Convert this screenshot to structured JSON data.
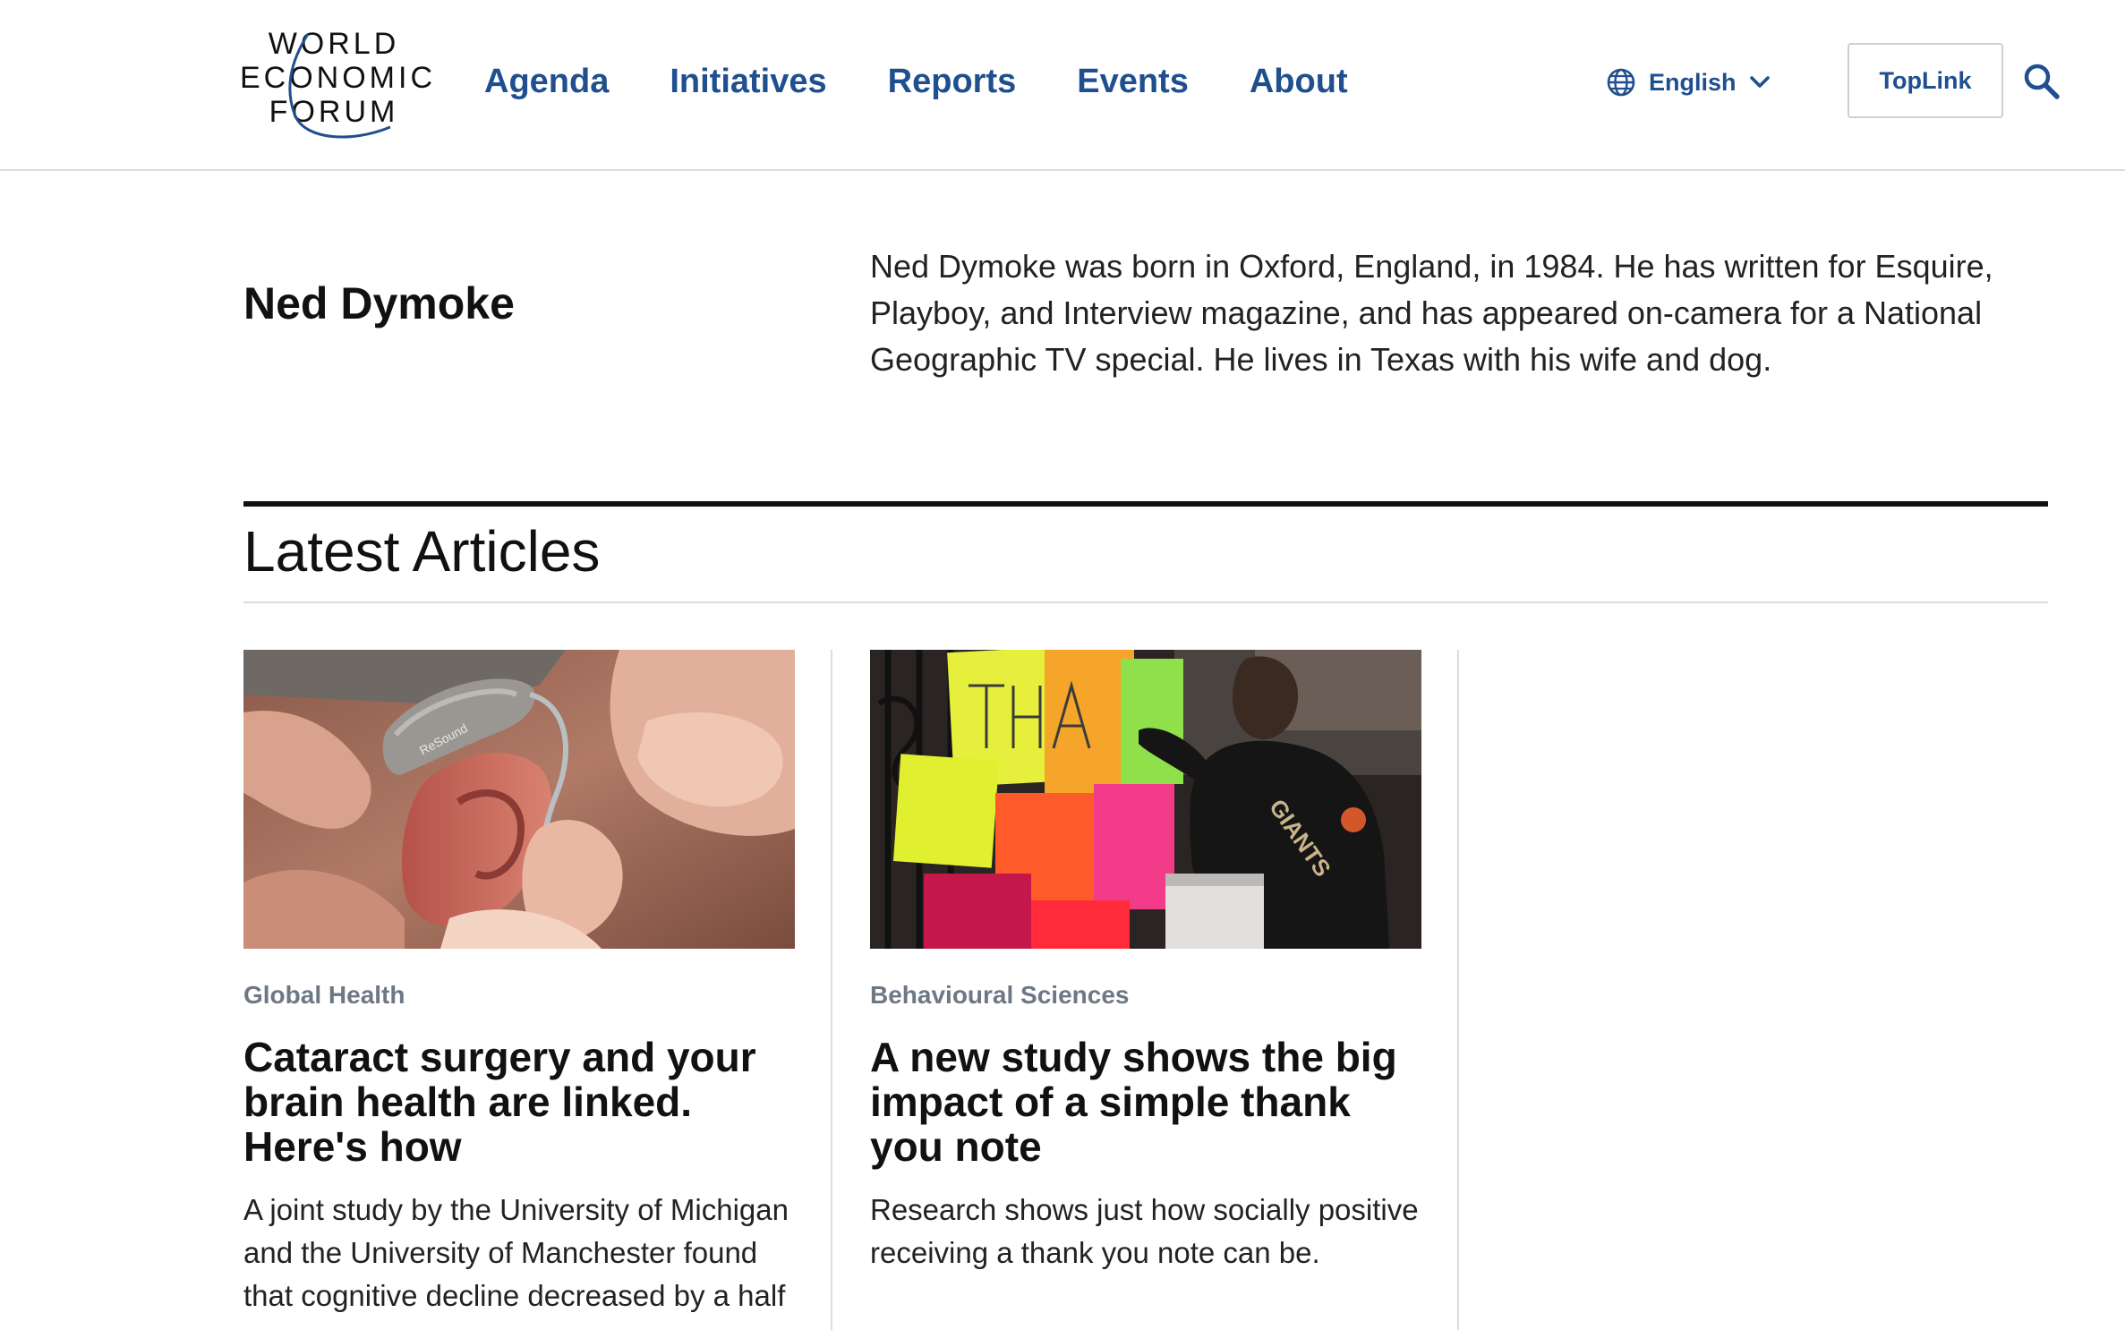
{
  "header": {
    "logo": {
      "line1": "WORLD",
      "line2": "ECONOMIC",
      "line3": "FORUM"
    },
    "nav": [
      {
        "label": "Agenda"
      },
      {
        "label": "Initiatives"
      },
      {
        "label": "Reports"
      },
      {
        "label": "Events"
      },
      {
        "label": "About"
      }
    ],
    "language": {
      "label": "English",
      "icon": "globe-icon"
    },
    "toplink_label": "TopLink",
    "search_icon": "search-icon",
    "accent_color": "#1f4f8f"
  },
  "author": {
    "name": "Ned Dymoke",
    "bio": "Ned Dymoke was born in Oxford, England, in 1984. He has written for Esquire, Playboy, and Interview magazine, and has appeared on-camera for a National Geographic TV special. He lives in Texas with his wife and dog."
  },
  "latest": {
    "title": "Latest Articles",
    "articles": [
      {
        "category": "Global Health",
        "title": "Cataract surgery and your brain health are linked. Here's how",
        "description": "A joint study by the University of Michigan and the University of Manchester found that cognitive decline decreased by a half",
        "image": "hearing-aid-photo"
      },
      {
        "category": "Behavioural Sciences",
        "title": "A new study shows the big impact of a simple thank you note",
        "description": "Research shows just how socially positive receiving a thank you note can be.",
        "image": "thank-you-notes-photo"
      }
    ]
  }
}
